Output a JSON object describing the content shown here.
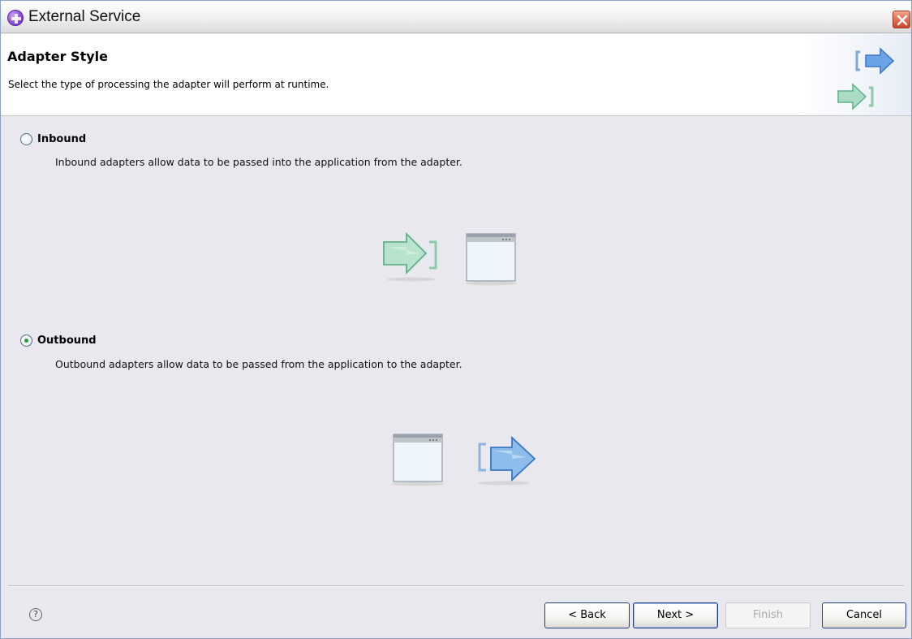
{
  "window": {
    "title": "External Service",
    "icon": "app-plugin-icon",
    "close_icon": "close-icon"
  },
  "banner": {
    "title": "Adapter Style",
    "description": "Select the type of processing the adapter will perform at runtime."
  },
  "options": [
    {
      "label": "Inbound",
      "description": "Inbound adapters allow data to be passed into the application from the adapter.",
      "selected": false
    },
    {
      "label": "Outbound",
      "description": "Outbound adapters allow data to be passed from the application to the adapter.",
      "selected": true
    }
  ],
  "footer": {
    "help_glyph": "?",
    "back_label": "< Back",
    "next_label": "Next >",
    "finish_label": "Finish",
    "cancel_label": "Cancel"
  },
  "colors": {
    "inbound_arrow": "#7dc7a4",
    "outbound_arrow": "#4f8fd6",
    "selected_radio_dot": "#2f9a3b"
  }
}
